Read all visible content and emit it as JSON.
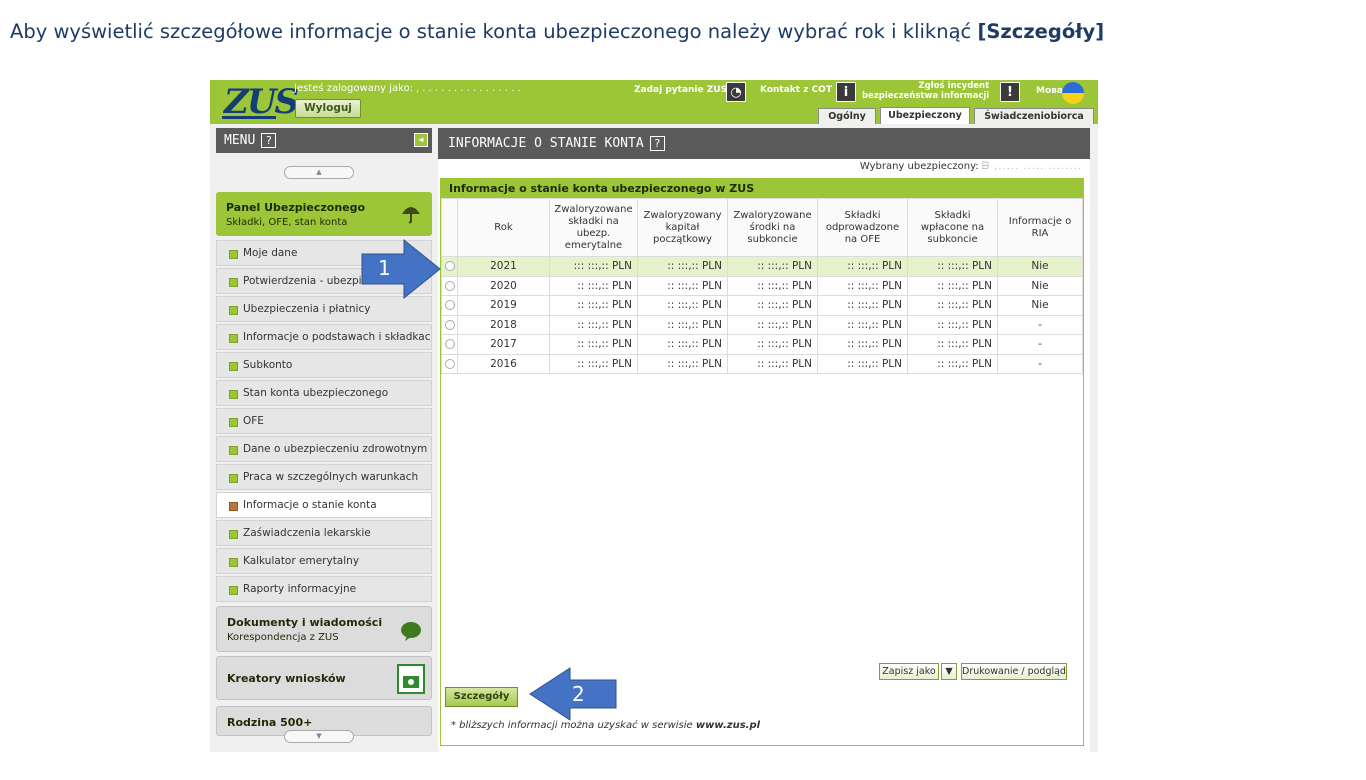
{
  "caption": {
    "text": "Aby wyświetlić szczegółowe informacje o stanie konta ubezpieczonego należy wybrać rok i kliknąć ",
    "bold": "[Szczegóły]"
  },
  "header": {
    "logo": "ZUS",
    "logged_as": "Jesteś zalogowany jako: ˌ . . . . . . . . . . . . . . . .",
    "logout": "Wyloguj",
    "ask": "Zadaj pytanie ZUS",
    "contact": "Kontakt z COT",
    "incident_line1": "Zgłoś incydent",
    "incident_line2": "bezpieczeństwa informacji",
    "lang": "Мова",
    "tabs": [
      "Ogólny",
      "Ubezpieczony",
      "Świadczeniobiorca"
    ],
    "active_tab": "Ubezpieczony"
  },
  "sidebar": {
    "menu_label": "MENU",
    "help": "?",
    "panel_title": "Panel Ubezpieczonego",
    "panel_sub": "Składki, OFE, stan konta",
    "items": [
      "Moje dane",
      "Potwierdzenia - ubezpieczenia",
      "Ubezpieczenia i płatnicy",
      "Informacje o podstawach i składkach",
      "Subkonto",
      "Stan konta ubezpieczonego",
      "OFE",
      "Dane o ubezpieczeniu zdrowotnym",
      "Praca w szczególnych warunkach",
      "Informacje o stanie konta",
      "Zaświadczenia lekarskie",
      "Kalkulator emerytalny",
      "Raporty informacyjne"
    ],
    "active_item": "Informacje o stanie konta",
    "docs_title": "Dokumenty i wiadomości",
    "docs_sub": "Korespondencja z ZUS",
    "creators": "Kreatory wniosków",
    "family": "Rodzina 500+"
  },
  "main": {
    "title": "INFORMACJE O STANIE KONTA",
    "help": "?",
    "selected_label": "Wybrany ubezpieczony:",
    "selected_value": "ᗷ ,..... ..... ........",
    "box_title": "Informacje o stanie konta ubezpieczonego w ZUS",
    "columns": [
      "",
      "Rok",
      "Zwaloryzowane składki na ubezp. emerytalne",
      "Zwaloryzowany kapitał początkowy",
      "Zwaloryzowane środki na subkoncie",
      "Składki odprowadzone na OFE",
      "Składki wpłacone na subkoncie",
      "Informacje o RIA"
    ],
    "rows": [
      {
        "year": "2021",
        "v1": "::: :::,:: PLN",
        "v2": ":: :::,:: PLN",
        "v3": ":: :::,:: PLN",
        "v4": ":: :::,:: PLN",
        "v5": ":: :::,:: PLN",
        "ria": "Nie"
      },
      {
        "year": "2020",
        "v1": ":: :::,:: PLN",
        "v2": ":: :::,:: PLN",
        "v3": ":: :::,:: PLN",
        "v4": ":: :::,:: PLN",
        "v5": ":: :::,:: PLN",
        "ria": "Nie"
      },
      {
        "year": "2019",
        "v1": ":: :::,:: PLN",
        "v2": ":: :::,:: PLN",
        "v3": ":: :::,:: PLN",
        "v4": ":: :::,:: PLN",
        "v5": ":: :::,:: PLN",
        "ria": "Nie"
      },
      {
        "year": "2018",
        "v1": ":: :::,:: PLN",
        "v2": ":: :::,:: PLN",
        "v3": ":: :::,:: PLN",
        "v4": ":: :::,:: PLN",
        "v5": ":: :::,:: PLN",
        "ria": "-"
      },
      {
        "year": "2017",
        "v1": ":: :::,:: PLN",
        "v2": ":: :::,:: PLN",
        "v3": ":: :::,:: PLN",
        "v4": ":: :::,:: PLN",
        "v5": ":: :::,:: PLN",
        "ria": "-"
      },
      {
        "year": "2016",
        "v1": ":: :::,:: PLN",
        "v2": ":: :::,:: PLN",
        "v3": ":: :::,:: PLN",
        "v4": ":: :::,:: PLN",
        "v5": ":: :::,:: PLN",
        "ria": "-"
      }
    ],
    "selected_row": "2021",
    "save_as": "Zapisz jako",
    "print": "Drukowanie / podgląd",
    "details": "Szczegóły",
    "note_prefix": "* bliższych informacji można uzyskać w serwisie ",
    "note_site": "www.zus.pl"
  },
  "annotations": {
    "arrow1": "1",
    "arrow2": "2",
    "arrow_color": "#4472c4"
  },
  "colors": {
    "accent_green": "#9cc538",
    "dark_header": "#5a5a5a",
    "zus_blue": "#133d74"
  }
}
